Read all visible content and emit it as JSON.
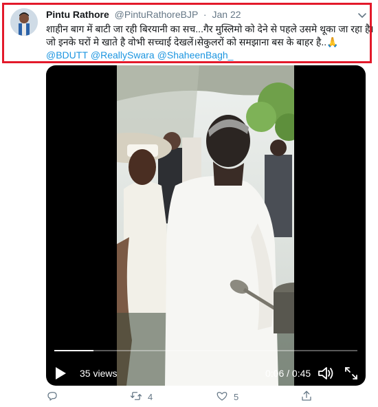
{
  "tweet": {
    "author_name": "Pintu Rathore",
    "author_handle": "@PintuRathoreBJP",
    "separator": "·",
    "date": "Jan 22",
    "text_lines": [
      "शाहीन बाग में बाटी जा रही बिरयानी का सच...गैर मुस्लिमो को देने से पहले उसमे थूका जा रहा है।",
      "जो इनके घरों मे खाते है वोभी सच्चाई देखलें।सेकुलरों को समझाना बस के बाहर है..🙏"
    ],
    "mentions": [
      "@BDUTT",
      "@ReallySwara",
      "@ShaheenBagh_"
    ]
  },
  "video": {
    "views": "35 views",
    "time": "0:06 / 0:45",
    "progress_fraction": 0.13
  },
  "actions": {
    "reply_count": "",
    "retweet_count": "4",
    "like_count": "5"
  },
  "colors": {
    "highlight_border": "#e3192a",
    "link": "#1b95e0",
    "muted": "#657786"
  },
  "icons": [
    "chevron-down-icon",
    "play-icon",
    "volume-icon",
    "fullscreen-icon",
    "reply-icon",
    "retweet-icon",
    "like-icon",
    "share-icon"
  ]
}
